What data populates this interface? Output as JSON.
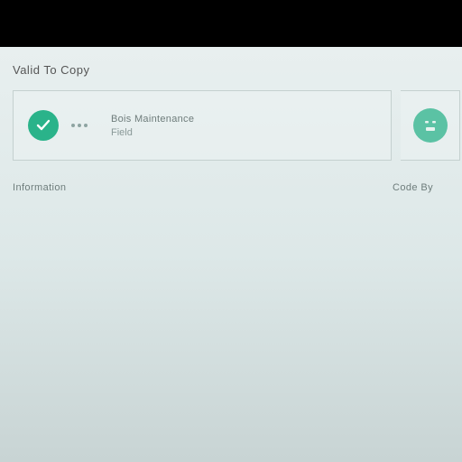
{
  "colors": {
    "accent": "#2ab38a",
    "accent_light": "#5bc2a4"
  },
  "section": {
    "label": "Valid To Copy"
  },
  "card": {
    "title": "Bois Maintenance",
    "subtitle": "Field"
  },
  "footer": {
    "left": "Information",
    "right": "Code By"
  },
  "icons": {
    "check": "checkmark-icon",
    "face": "face-icon"
  }
}
